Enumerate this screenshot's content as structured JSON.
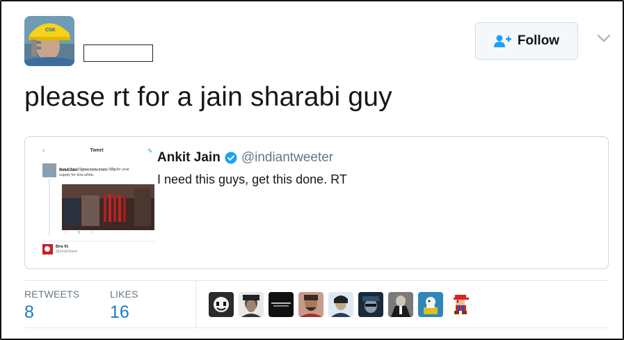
{
  "header": {
    "avatar_icon": "user-avatar",
    "follow_label": "Follow",
    "follow_icon": "add-person-icon",
    "menu_icon": "chevron-down-icon",
    "colors": {
      "follow_icon": "#1da1f2",
      "accent": "#1b7ac4"
    }
  },
  "tweet": {
    "text": "please rt for a jain sharabi guy"
  },
  "quote": {
    "name": "Ankit Jain",
    "verified_icon": "verified-badge-icon",
    "handle": "@indiantweeter",
    "text": "I need this guys, get this done. RT",
    "thumbnail": {
      "header": "Tweet",
      "author": "Ankit Jain",
      "handle": "@indiantweeter · 10h",
      "line1": "Hey @bira91beer how many RTs for year",
      "line2": "supply for bira white.",
      "actions": [
        "7",
        "8",
        "2"
      ],
      "reply_name": "Bira 91",
      "reply_handle": "@bira91beer"
    }
  },
  "stats": {
    "retweets_label": "RETWEETS",
    "retweets_value": "8",
    "likes_label": "LIKES",
    "likes_value": "16"
  },
  "likers": [
    "liker-avatar-1",
    "liker-avatar-2",
    "liker-avatar-3",
    "liker-avatar-4",
    "liker-avatar-5",
    "liker-avatar-6",
    "liker-avatar-7",
    "liker-avatar-8",
    "liker-avatar-9"
  ]
}
